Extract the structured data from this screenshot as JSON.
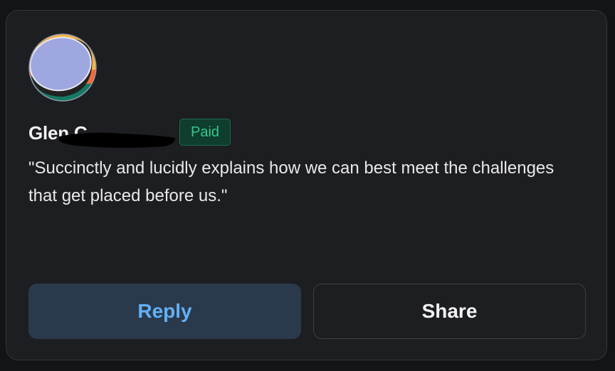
{
  "comment": {
    "author_name": "Glen C.",
    "badge_label": "Paid",
    "quote": "\"Succinctly and lucidly explains how we can best meet the challenges that get placed before us.\""
  },
  "actions": {
    "reply_label": "Reply",
    "share_label": "Share"
  },
  "colors": {
    "background": "#131416",
    "card": "#1d1e21",
    "badge_text": "#35c98b",
    "reply_accent": "#63b0f5"
  }
}
